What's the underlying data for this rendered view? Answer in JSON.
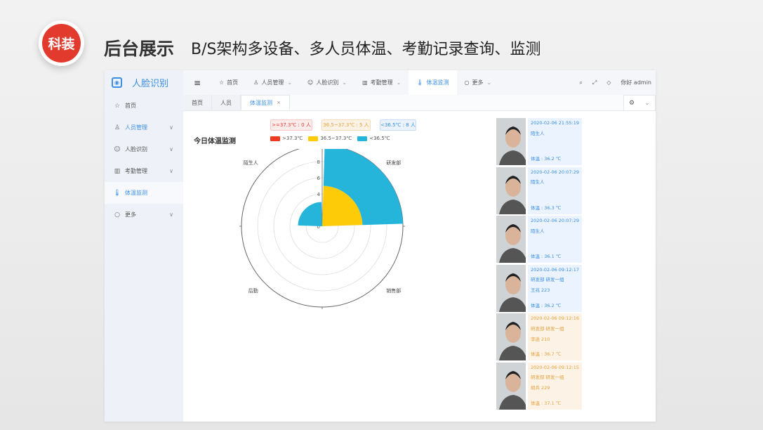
{
  "slide": {
    "badge": "科装",
    "title": "后台展示",
    "subtitle": "B/S架构多设备、多人员体温、考勤记录查询、监测"
  },
  "app": {
    "logo_text": "人脸识别",
    "sidebar": [
      {
        "label": "首页",
        "icon": "star-icon",
        "chevron": false,
        "active": false
      },
      {
        "label": "人员管理",
        "icon": "user-icon",
        "chevron": true,
        "active": false
      },
      {
        "label": "人脸识别",
        "icon": "face-icon",
        "chevron": true,
        "active": false
      },
      {
        "label": "考勤管理",
        "icon": "bar-chart-icon",
        "chevron": true,
        "active": false
      },
      {
        "label": "体温监测",
        "icon": "thermometer-icon",
        "chevron": false,
        "active": true
      },
      {
        "label": "更多",
        "icon": "circle-icon",
        "chevron": true,
        "active": false
      }
    ],
    "topnav": [
      {
        "label": "首页",
        "icon": "star-icon"
      },
      {
        "label": "人员管理",
        "icon": "user-icon"
      },
      {
        "label": "人脸识别",
        "icon": "face-icon"
      },
      {
        "label": "考勤管理",
        "icon": "bar-chart-icon"
      },
      {
        "label": "体温监测",
        "icon": "thermometer-icon"
      },
      {
        "label": "更多",
        "icon": "circle-icon"
      }
    ],
    "greeting": "你好 admin",
    "tabs": [
      {
        "label": "首页",
        "active": false
      },
      {
        "label": "人员",
        "active": false
      },
      {
        "label": "体温监测",
        "active": true
      }
    ]
  },
  "summary": {
    "high": ">=37.3℃ : 0 人",
    "mid": "36.5~37.3℃ : 5 人",
    "low": "<36.5℃ : 8 人"
  },
  "chart_data": {
    "type": "polar-bar",
    "title": "今日体温监测",
    "categories": [
      "研发部",
      "销售部",
      "后勤",
      "陌生人"
    ],
    "series": [
      {
        "name": ">37.3℃",
        "color": "#ee3b1f",
        "values": [
          0,
          0,
          0,
          0
        ]
      },
      {
        "name": "36.5~37.3℃",
        "color": "#fdcb07",
        "values": [
          5,
          0,
          0,
          0
        ]
      },
      {
        "name": "<36.5℃",
        "color": "#25b5db",
        "values": [
          5,
          0,
          0,
          3
        ]
      }
    ],
    "radial_ticks": [
      "0",
      "2",
      "4",
      "6",
      "8",
      "10"
    ],
    "radial_max": 10
  },
  "records": [
    {
      "time": "2020-02-06 21:55:19",
      "line1": "陌生人",
      "line2": "",
      "temp": "体温 : 36.2 ℃",
      "status": "normal"
    },
    {
      "time": "2020-02-06 20:07:29",
      "line1": "陌生人",
      "line2": "",
      "temp": "体温 : 36.3 ℃",
      "status": "normal"
    },
    {
      "time": "2020-02-06 20:07:29",
      "line1": "陌生人",
      "line2": "",
      "temp": "体温 : 36.1 ℃",
      "status": "normal"
    },
    {
      "time": "2020-02-06 09:12:17",
      "line1": "研发部  研发一组",
      "line2": "王兆  223",
      "temp": "体温 : 36.2 ℃",
      "status": "normal"
    },
    {
      "time": "2020-02-06 09:12:16",
      "line1": "研发部  研发一组",
      "line2": "李逍  210",
      "temp": "体温 : 36.7 ℃",
      "status": "warm"
    },
    {
      "time": "2020-02-06 09:12:15",
      "line1": "研发部  研发一组",
      "line2": "胡兵  229",
      "temp": "体温 : 37.1 ℃",
      "status": "warm"
    }
  ]
}
